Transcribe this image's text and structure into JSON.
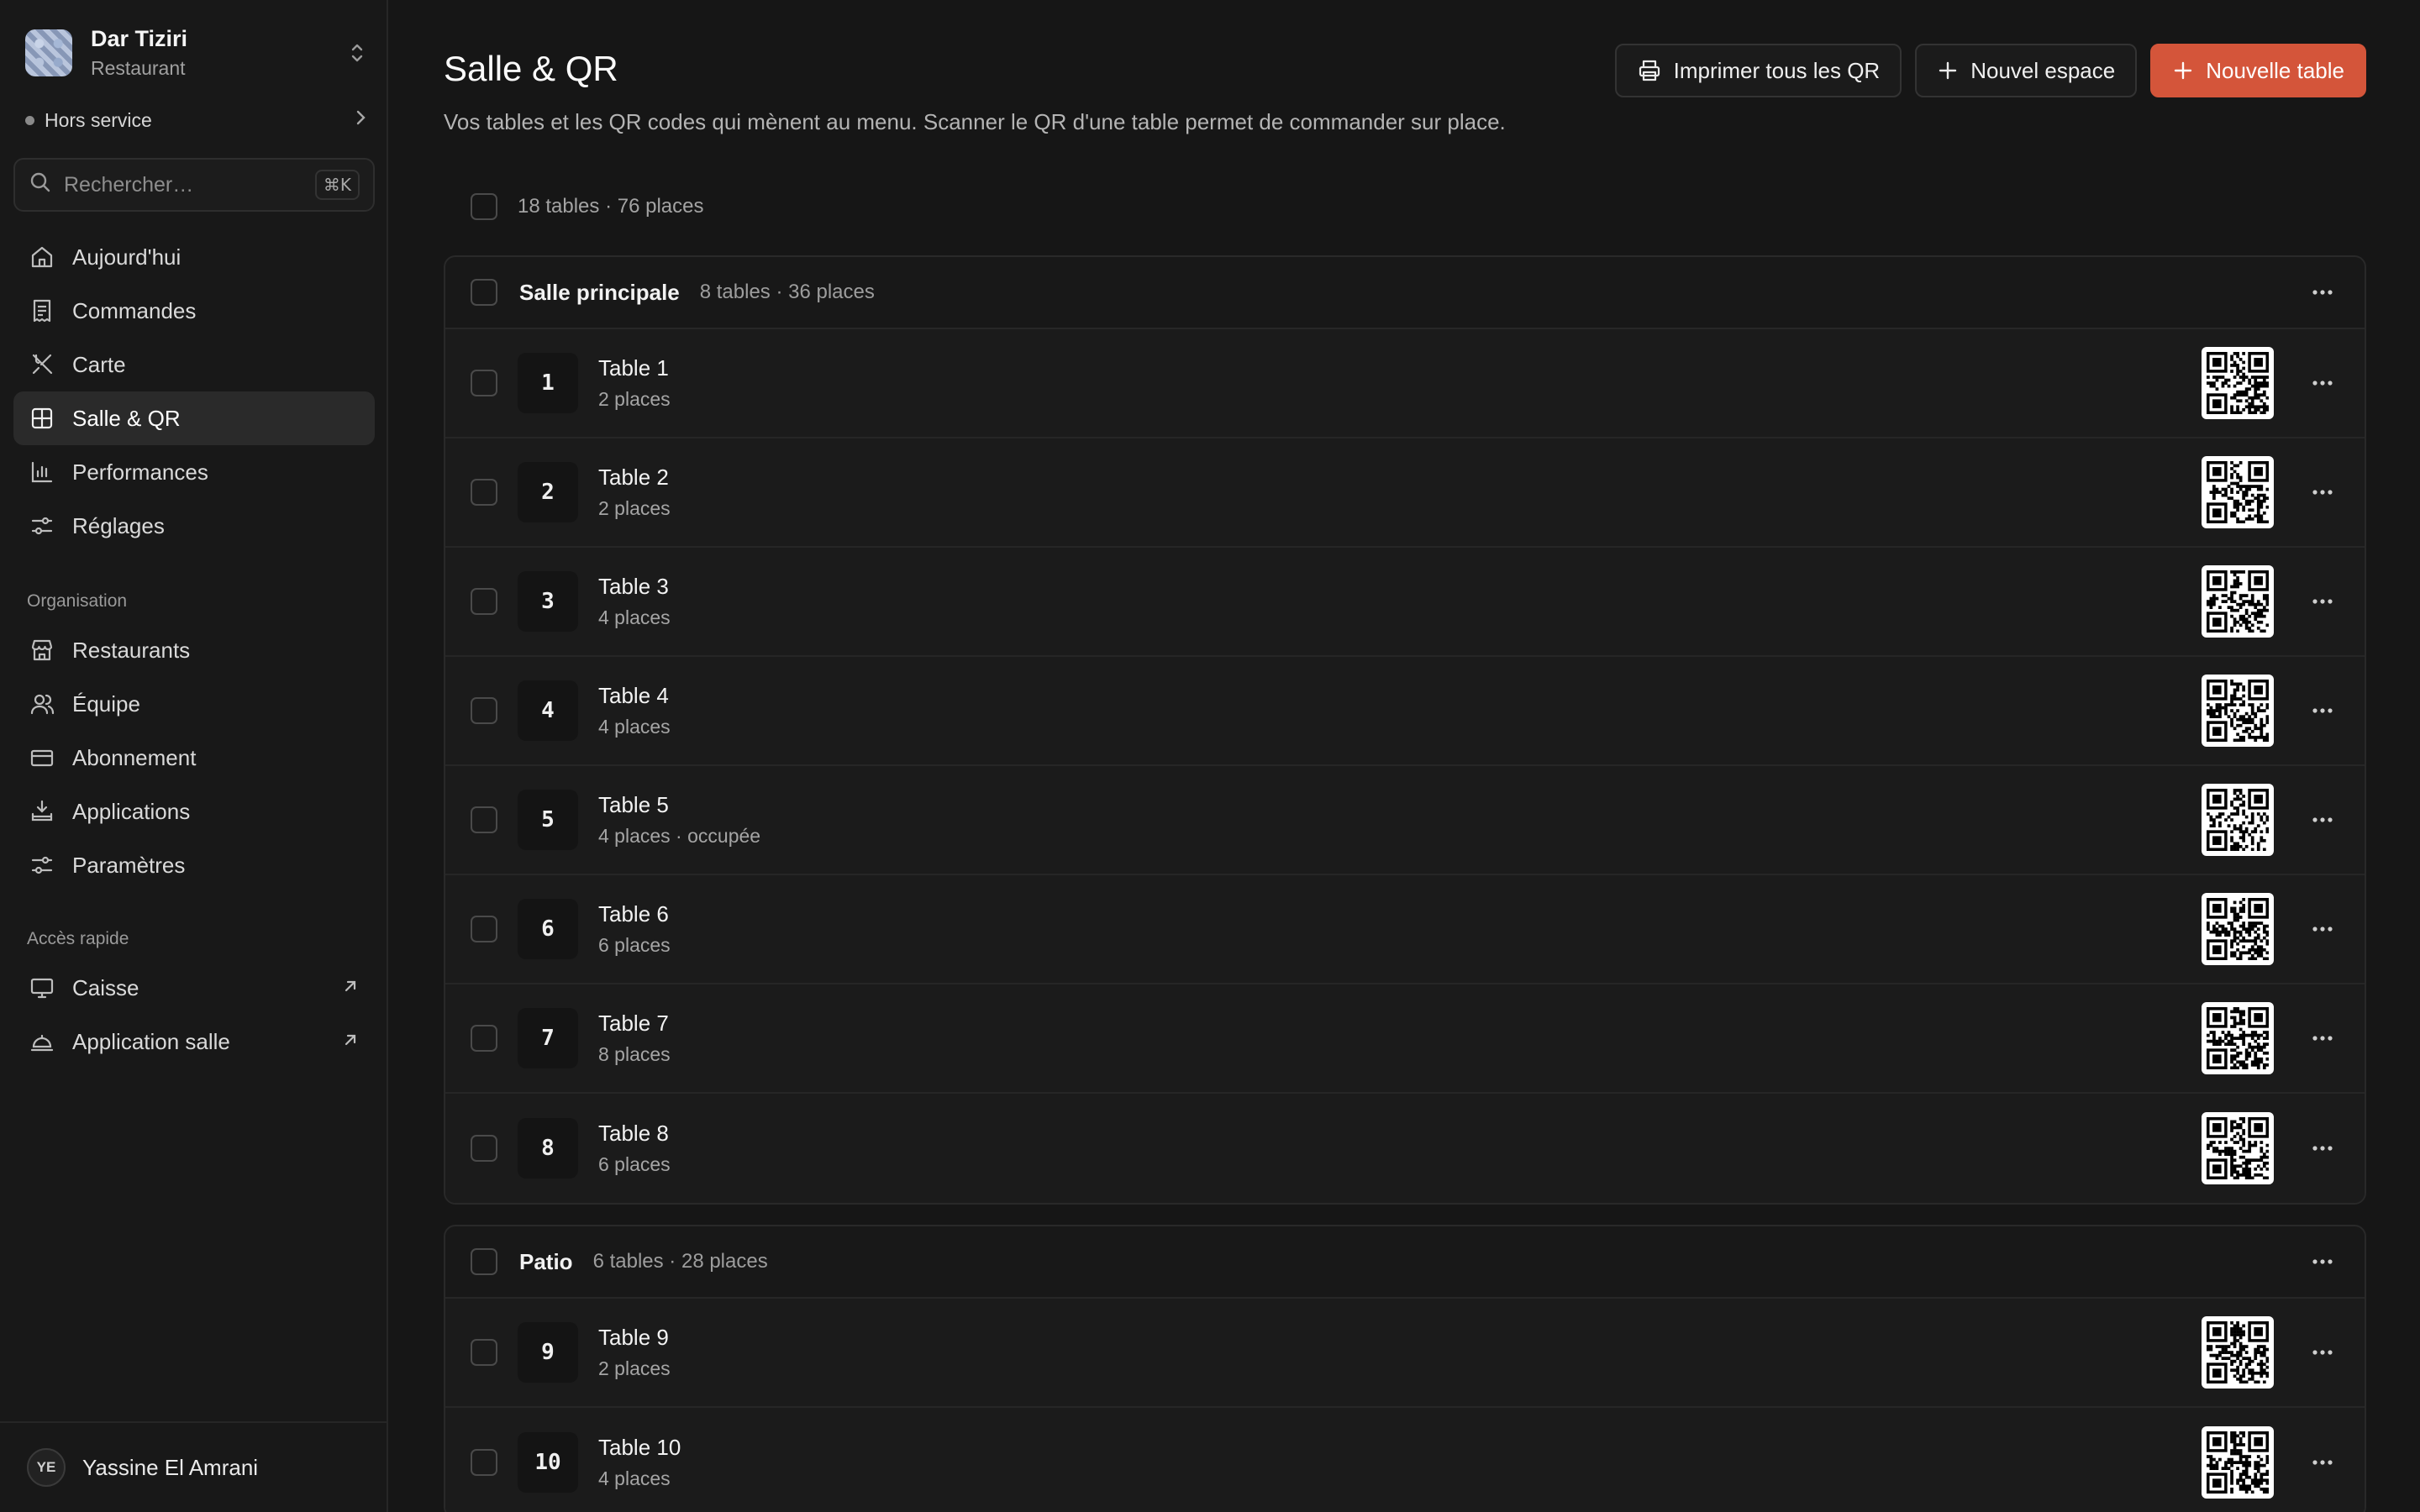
{
  "workspace": {
    "name": "Dar Tiziri",
    "type": "Restaurant"
  },
  "status": {
    "label": "Hors service"
  },
  "search": {
    "placeholder": "Rechercher…",
    "shortcut": "⌘K"
  },
  "nav": {
    "main": [
      {
        "label": "Aujourd'hui",
        "icon": "home-icon"
      },
      {
        "label": "Commandes",
        "icon": "receipt-icon"
      },
      {
        "label": "Carte",
        "icon": "utensils-icon"
      },
      {
        "label": "Salle & QR",
        "icon": "grid-icon",
        "active": true
      },
      {
        "label": "Performances",
        "icon": "bar-chart-icon"
      },
      {
        "label": "Réglages",
        "icon": "sliders-icon"
      }
    ],
    "org_label": "Organisation",
    "org": [
      {
        "label": "Restaurants",
        "icon": "store-icon"
      },
      {
        "label": "Équipe",
        "icon": "users-icon"
      },
      {
        "label": "Abonnement",
        "icon": "credit-card-icon"
      },
      {
        "label": "Applications",
        "icon": "apps-icon"
      },
      {
        "label": "Paramètres",
        "icon": "settings-sliders-icon"
      }
    ],
    "quick_label": "Accès rapide",
    "quick": [
      {
        "label": "Caisse",
        "icon": "monitor-icon"
      },
      {
        "label": "Application salle",
        "icon": "cloche-icon"
      }
    ]
  },
  "user": {
    "initials": "YE",
    "name": "Yassine El Amrani"
  },
  "page": {
    "title": "Salle & QR",
    "description": "Vos tables et les QR codes qui mènent au menu. Scanner le QR d'une table permet de commander sur place.",
    "summary": "18 tables · 76 places"
  },
  "actions": {
    "print_all": "Imprimer tous les QR",
    "new_space": "Nouvel espace",
    "new_table": "Nouvelle table"
  },
  "colors": {
    "accent": "#d4553a",
    "background": "#161616"
  },
  "groups": [
    {
      "name": "Salle principale",
      "meta": "8 tables · 36 places",
      "tables": [
        {
          "num": "1",
          "name": "Table 1",
          "sub": "2 places"
        },
        {
          "num": "2",
          "name": "Table 2",
          "sub": "2 places"
        },
        {
          "num": "3",
          "name": "Table 3",
          "sub": "4 places"
        },
        {
          "num": "4",
          "name": "Table 4",
          "sub": "4 places"
        },
        {
          "num": "5",
          "name": "Table 5",
          "sub": "4 places · occupée"
        },
        {
          "num": "6",
          "name": "Table 6",
          "sub": "6 places"
        },
        {
          "num": "7",
          "name": "Table 7",
          "sub": "8 places"
        },
        {
          "num": "8",
          "name": "Table 8",
          "sub": "6 places"
        }
      ]
    },
    {
      "name": "Patio",
      "meta": "6 tables · 28 places",
      "tables": [
        {
          "num": "9",
          "name": "Table 9",
          "sub": "2 places"
        },
        {
          "num": "10",
          "name": "Table 10",
          "sub": "4 places"
        }
      ]
    }
  ]
}
